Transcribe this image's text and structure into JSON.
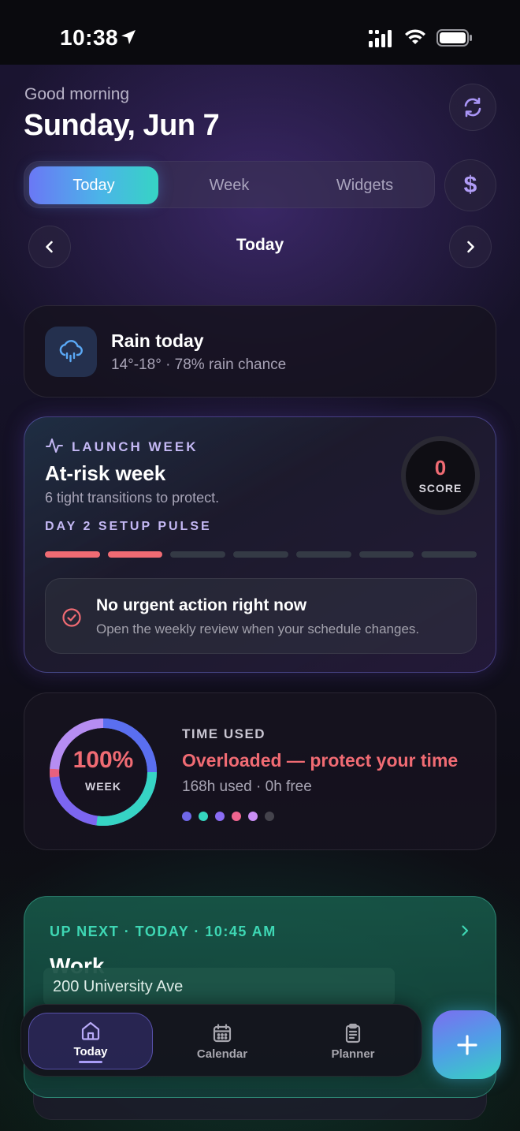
{
  "status_bar": {
    "time": "10:38"
  },
  "header": {
    "greeting": "Good morning",
    "date": "Sunday, Jun 7"
  },
  "segments": {
    "today": "Today",
    "week": "Week",
    "widgets": "Widgets",
    "active": "Today"
  },
  "currency_symbol": "$",
  "date_nav": {
    "label": "Today"
  },
  "weather": {
    "title": "Rain today",
    "subtitle": "14°-18° · 78% rain chance",
    "icon": "rain-cloud-icon"
  },
  "launch": {
    "kicker": "LAUNCH WEEK",
    "title": "At-risk week",
    "subtitle": "6 tight transitions to protect.",
    "pulse_label": "DAY 2 SETUP PULSE",
    "pulse_segments_total": 7,
    "pulse_segments_done": 2,
    "score_value": "0",
    "score_label": "SCORE",
    "status_title": "No urgent action right now",
    "status_subtitle": "Open the weekly review when your schedule changes."
  },
  "time_used": {
    "percent_label": "100%",
    "period_label": "WEEK",
    "kicker": "TIME USED",
    "title": "Overloaded — protect your time",
    "subtitle": "168h used · 0h free",
    "dot_colors": [
      "#6f67e8",
      "#35d6bf",
      "#8a6cf4",
      "#f0658f",
      "#c98ef4",
      "#44434c"
    ]
  },
  "up_next": {
    "kicker": "UP NEXT · TODAY · 10:45 AM",
    "title": "Work",
    "address": "200 University Ave"
  },
  "tab_bar": {
    "today": "Today",
    "calendar": "Calendar",
    "planner": "Planner",
    "active": "Today"
  },
  "colors": {
    "accent": "#6a78f5",
    "teal": "#36d4c4",
    "danger": "#f06b73",
    "lavender": "#c4b8f4"
  }
}
